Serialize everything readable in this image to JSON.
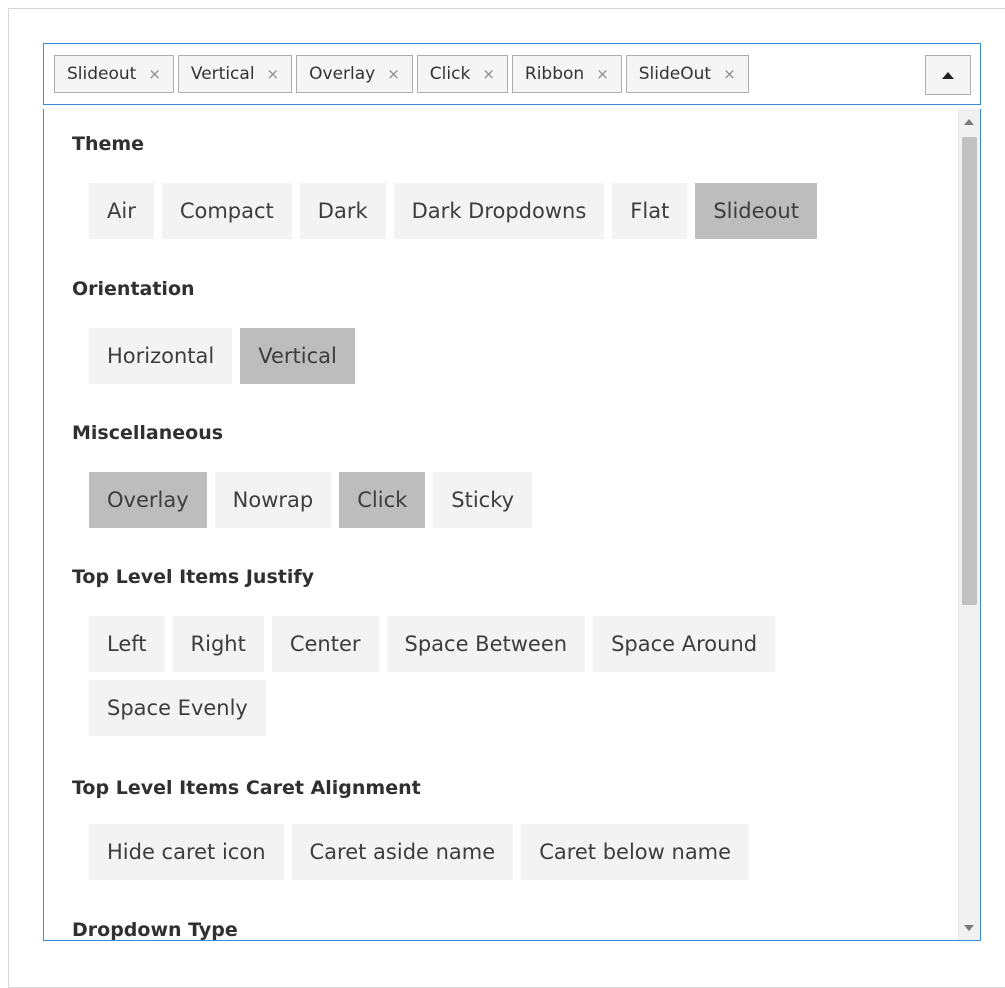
{
  "selected_chips": [
    {
      "label": "Slideout"
    },
    {
      "label": "Vertical"
    },
    {
      "label": "Overlay"
    },
    {
      "label": "Click"
    },
    {
      "label": "Ribbon"
    },
    {
      "label": "SlideOut"
    }
  ],
  "remove_glyph": "×",
  "groups": [
    {
      "title": "Theme",
      "options": [
        {
          "label": "Air",
          "selected": false
        },
        {
          "label": "Compact",
          "selected": false
        },
        {
          "label": "Dark",
          "selected": false
        },
        {
          "label": "Dark Dropdowns",
          "selected": false
        },
        {
          "label": "Flat",
          "selected": false
        },
        {
          "label": "Slideout",
          "selected": true
        }
      ]
    },
    {
      "title": "Orientation",
      "options": [
        {
          "label": "Horizontal",
          "selected": false
        },
        {
          "label": "Vertical",
          "selected": true
        }
      ]
    },
    {
      "title": "Miscellaneous",
      "options": [
        {
          "label": "Overlay",
          "selected": true
        },
        {
          "label": "Nowrap",
          "selected": false
        },
        {
          "label": "Click",
          "selected": true
        },
        {
          "label": "Sticky",
          "selected": false
        }
      ]
    },
    {
      "title": "Top Level Items Justify",
      "options": [
        {
          "label": "Left",
          "selected": false
        },
        {
          "label": "Right",
          "selected": false
        },
        {
          "label": "Center",
          "selected": false
        },
        {
          "label": "Space Between",
          "selected": false
        },
        {
          "label": "Space Around",
          "selected": false
        },
        {
          "label": "Space Evenly",
          "selected": false
        }
      ]
    },
    {
      "title": "Top Level Items Caret Alignment",
      "options": [
        {
          "label": "Hide caret icon",
          "selected": false
        },
        {
          "label": "Caret aside name",
          "selected": false
        },
        {
          "label": "Caret below name",
          "selected": false
        }
      ]
    },
    {
      "title": "Dropdown Type",
      "options": []
    }
  ],
  "colors": {
    "focus_border": "#3c8bd8",
    "option_bg": "#f3f3f3",
    "option_selected_bg": "#bdbdbd"
  }
}
